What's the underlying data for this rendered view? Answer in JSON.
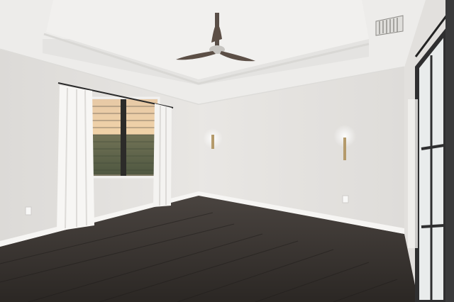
{
  "scene": {
    "subject": "empty-bedroom",
    "elements": [
      "tray-ceiling",
      "ceiling-fan",
      "hvac-vent",
      "window-with-blinds",
      "sheer-curtains",
      "wall-sconces",
      "barn-door",
      "dark-wood-floor",
      "baseboards",
      "outlets"
    ],
    "colors": {
      "wall": "#e6e4e1",
      "wall_shadow": "#d9d7d4",
      "ceiling": "#eeedeb",
      "floor_dark": "#2e2a27",
      "floor_light": "#4a4440",
      "trim": "#f5f4f2",
      "fan": "#5a4f48",
      "door_frame": "#2f2f30",
      "door_glass": "#e8ebec"
    }
  }
}
